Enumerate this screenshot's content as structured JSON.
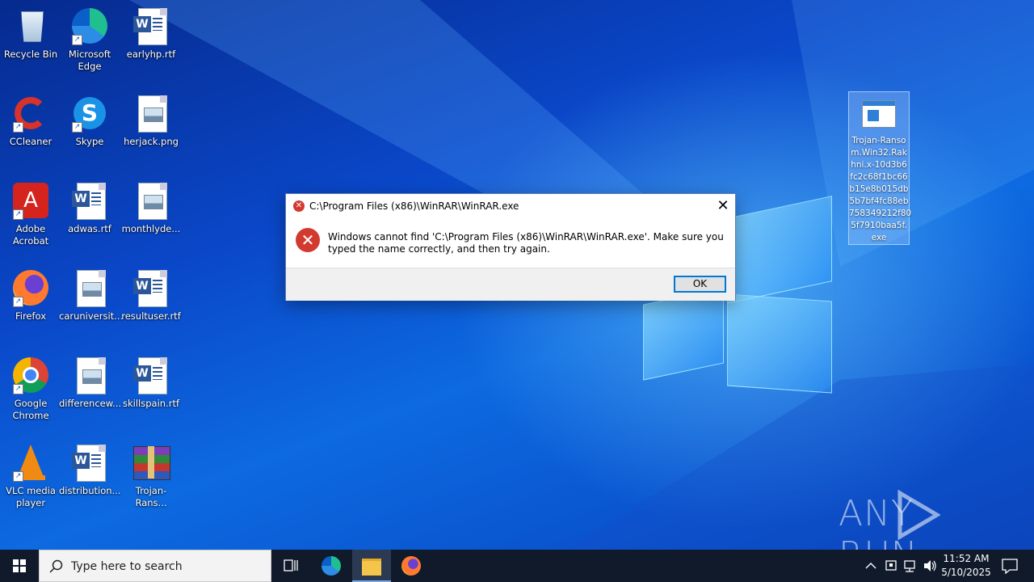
{
  "desktop_icons": [
    {
      "label": "Recycle Bin",
      "icon": "recycle-bin-icon"
    },
    {
      "label": "Microsoft Edge",
      "icon": "edge-icon"
    },
    {
      "label": "earlyhp.rtf",
      "icon": "word-document-icon"
    },
    {
      "label": "CCleaner",
      "icon": "ccleaner-icon"
    },
    {
      "label": "Skype",
      "icon": "skype-icon"
    },
    {
      "label": "herjack.png",
      "icon": "image-file-icon"
    },
    {
      "label": "Adobe Acrobat",
      "icon": "acrobat-icon"
    },
    {
      "label": "adwas.rtf",
      "icon": "word-document-icon"
    },
    {
      "label": "monthlyde...",
      "icon": "image-file-icon"
    },
    {
      "label": "Firefox",
      "icon": "firefox-icon"
    },
    {
      "label": "caruniversit...",
      "icon": "image-file-icon"
    },
    {
      "label": "resultuser.rtf",
      "icon": "word-document-icon"
    },
    {
      "label": "Google Chrome",
      "icon": "chrome-icon"
    },
    {
      "label": "differencew...",
      "icon": "image-file-icon"
    },
    {
      "label": "skillspain.rtf",
      "icon": "word-document-icon"
    },
    {
      "label": "VLC media player",
      "icon": "vlc-icon"
    },
    {
      "label": "distribution...",
      "icon": "word-document-icon"
    },
    {
      "label": "Trojan-Rans...",
      "icon": "winrar-archive-icon"
    }
  ],
  "selected_file": {
    "label": "Trojan-Ransom.Win32.Rakhni.x-10d3b6fc2c68f1bc66b15e8b015db5b7bf4fc88eb758349212f805f7910baa5f.exe",
    "label_lines": [
      "Trojan-Ranso",
      "m.Win32.Rak",
      "hni.x-10d3b6",
      "fc2c68f1bc66",
      "b15e8b015db",
      "5b7bf4fc88eb",
      "758349212f80",
      "5f7910baa5f.",
      "exe"
    ]
  },
  "dialog": {
    "title": "C:\\Program Files (x86)\\WinRAR\\WinRAR.exe",
    "message": "Windows cannot find 'C:\\Program Files (x86)\\WinRAR\\WinRAR.exe'. Make sure you typed the name correctly, and then try again.",
    "ok_label": "OK",
    "close_glyph": "✕"
  },
  "watermark": {
    "text": "ANY RUN"
  },
  "taskbar": {
    "search_placeholder": "Type here to search",
    "time": "11:52 AM",
    "date": "5/10/2025"
  },
  "colors": {
    "error_red": "#d23a30",
    "taskbar": "#101a2b",
    "accent": "#0078d7"
  }
}
